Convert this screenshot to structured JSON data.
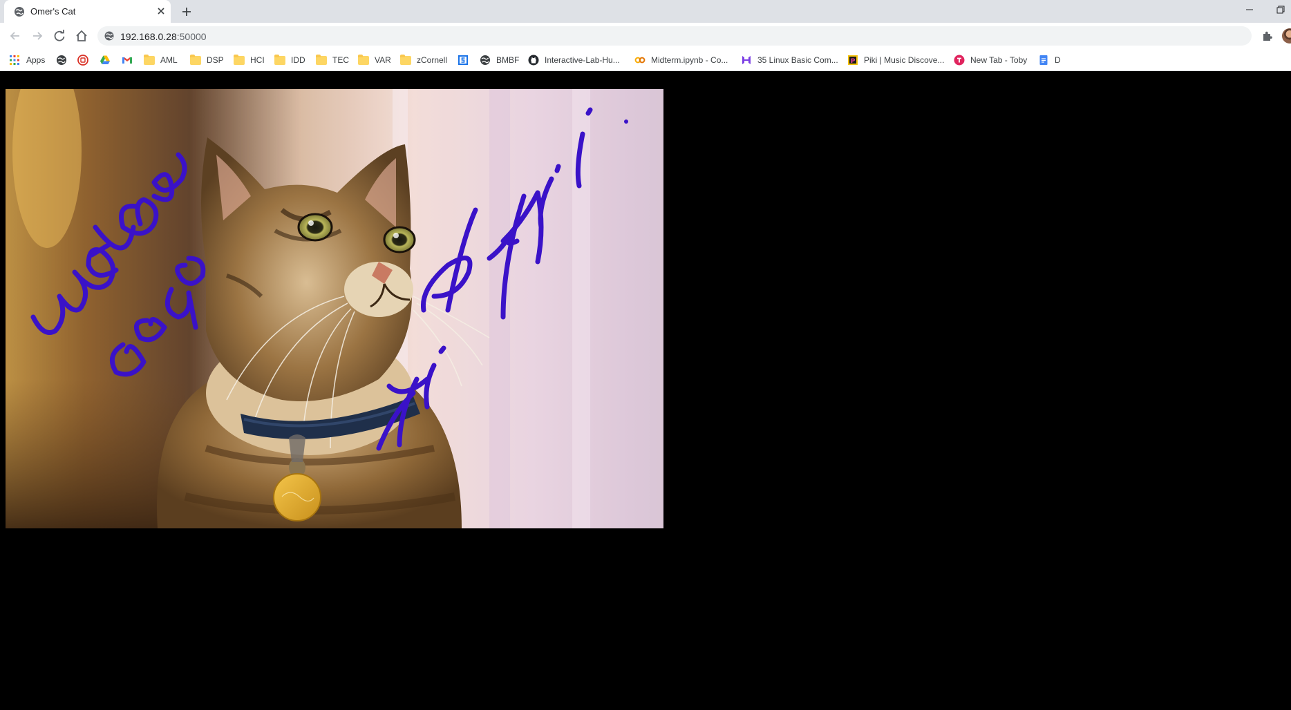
{
  "browser": {
    "tab": {
      "title": "Omer's Cat"
    },
    "address": {
      "host": "192.168.0.28",
      "port": ":50000"
    },
    "bookmarks": [
      {
        "label": "Apps",
        "icon": "apps-grid-icon"
      },
      {
        "label": "",
        "icon": "globe-icon"
      },
      {
        "label": "",
        "icon": "red-circle-site-icon"
      },
      {
        "label": "",
        "icon": "google-drive-icon"
      },
      {
        "label": "",
        "icon": "gmail-icon"
      },
      {
        "label": "AML",
        "icon": "folder-icon"
      },
      {
        "label": "DSP",
        "icon": "folder-icon"
      },
      {
        "label": "HCI",
        "icon": "folder-icon"
      },
      {
        "label": "IDD",
        "icon": "folder-icon"
      },
      {
        "label": "TEC",
        "icon": "folder-icon"
      },
      {
        "label": "VAR",
        "icon": "folder-icon"
      },
      {
        "label": "zCornell",
        "icon": "folder-icon"
      },
      {
        "label": "",
        "icon": "blue-s-site-icon"
      },
      {
        "label": "BMBF",
        "icon": "globe-icon"
      },
      {
        "label": "Interactive-Lab-Hu...",
        "icon": "github-icon"
      },
      {
        "label": "Midterm.ipynb - Co...",
        "icon": "colab-icon"
      },
      {
        "label": "35 Linux Basic Com...",
        "icon": "purple-h-site-icon"
      },
      {
        "label": "Piki | Music Discove...",
        "icon": "piki-icon"
      },
      {
        "label": "New Tab - Toby",
        "icon": "toby-icon"
      },
      {
        "label": "D",
        "icon": "google-docs-icon"
      }
    ],
    "colors": {
      "tabstrip": "#dee1e6",
      "omnibox": "#f1f3f4",
      "ink": "#3a12c8"
    }
  },
  "page": {
    "background": "#000000",
    "image_alt": "tabby cat looking up, wearing a blue collar with a gold tag",
    "handwriting": [
      "watson",
      "says",
      "Hi Parthidi !"
    ]
  }
}
